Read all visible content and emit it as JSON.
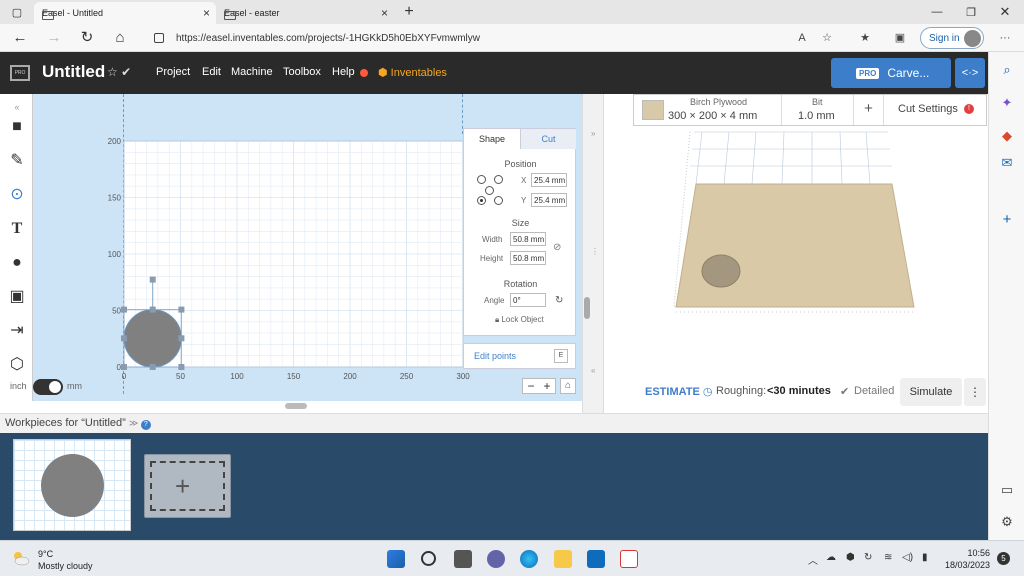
{
  "browser": {
    "tabs": [
      {
        "title": "Easel - Untitled"
      },
      {
        "title": "Easel - easter"
      }
    ],
    "url": "https://easel.inventables.com/projects/-1HGKkD5h0EbXYFvmwmlyw",
    "signin_label": "Sign in"
  },
  "app": {
    "title": "Untitled",
    "menu": [
      "Project",
      "Edit",
      "Machine",
      "Toolbox",
      "Help"
    ],
    "brand": "Inventables",
    "carve": {
      "pro_badge": "PRO",
      "label": "Carve..."
    },
    "logo_text": "PRO"
  },
  "canvas": {
    "y_ticks": [
      "200",
      "150",
      "100",
      "50",
      "0"
    ],
    "x_ticks": [
      "0",
      "50",
      "100",
      "150",
      "200",
      "250",
      "300"
    ],
    "unit_left": "inch",
    "unit_right": "mm",
    "shape_circle": {
      "x_mm": 25.4,
      "y_mm": 25.4,
      "diameter_mm": 50.8
    }
  },
  "props": {
    "tabs": [
      "Shape",
      "Cut"
    ],
    "position_heading": "Position",
    "x_label": "X",
    "x_value": "25.4 mm",
    "y_label": "Y",
    "y_value": "25.4 mm",
    "size_heading": "Size",
    "width_label": "Width",
    "width_value": "50.8 mm",
    "height_label": "Height",
    "height_value": "50.8 mm",
    "rotation_heading": "Rotation",
    "angle_label": "Angle",
    "angle_value": "0°",
    "lock_label": "Lock Object",
    "edit_points": "Edit points",
    "edit_points_key": "E"
  },
  "material": {
    "name": "Birch Plywood",
    "dims": "300 × 200 × 4 mm",
    "bit_label": "Bit",
    "bit_value": "1.0 mm",
    "cut_settings": "Cut Settings"
  },
  "estimate": {
    "label": "ESTIMATE",
    "roughing_label": "Roughing:",
    "roughing_value": "<30 minutes",
    "detailed": "Detailed",
    "simulate": "Simulate"
  },
  "workpieces": {
    "heading": "Workpieces for “Untitled”"
  },
  "taskbar": {
    "temp": "9°C",
    "weather": "Mostly cloudy",
    "time": "10:56",
    "date": "18/03/2023",
    "notifications": "5"
  },
  "colors": {
    "accent": "#3d7ecb",
    "header": "#2a2a2a",
    "canvas_bg": "#cde4f7",
    "shape": "#808080",
    "brand": "#f5a623"
  }
}
